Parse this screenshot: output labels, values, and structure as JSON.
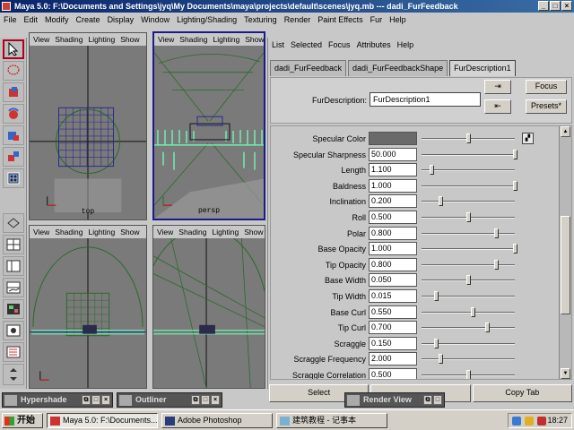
{
  "window": {
    "title": "Maya 5.0: F:\\Documents and Settings\\jyq\\My Documents\\maya\\projects\\default\\scenes\\jyq.mb  ---  dadi_FurFeedback",
    "buttons": [
      "_",
      "□",
      "×"
    ]
  },
  "menubar": [
    "File",
    "Edit",
    "Modify",
    "Create",
    "Display",
    "Window",
    "Lighting/Shading",
    "Texturing",
    "Render",
    "Paint Effects",
    "Fur",
    "Help"
  ],
  "viewports": [
    {
      "menu": [
        "View",
        "Shading",
        "Lighting",
        "Show"
      ],
      "label": "top"
    },
    {
      "menu": [
        "View",
        "Shading",
        "Lighting",
        "Show"
      ],
      "label": "persp"
    },
    {
      "menu": [
        "View",
        "Shading",
        "Lighting",
        "Show"
      ],
      "label": ""
    },
    {
      "menu": [
        "View",
        "Shading",
        "Lighting",
        "Show"
      ],
      "label": ""
    }
  ],
  "attribute_editor": {
    "menu": [
      "List",
      "Selected",
      "Focus",
      "Attributes",
      "Help"
    ],
    "tabs": [
      "dadi_FurFeedback",
      "dadi_FurFeedbackShape",
      "FurDescription1"
    ],
    "active_tab": 2,
    "field_label": "FurDescription:",
    "field_value": "FurDescription1",
    "focus_button": "Focus",
    "presets_button": "Presets*",
    "attributes": [
      {
        "label": "Specular Color",
        "value": "",
        "slider": 0.5,
        "color": "#6a6a6a",
        "map": true
      },
      {
        "label": "Specular Sharpness",
        "value": "50.000",
        "slider": 1.0
      },
      {
        "label": "Length",
        "value": "1.100",
        "slider": 0.11
      },
      {
        "label": "Baldness",
        "value": "1.000",
        "slider": 1.0
      },
      {
        "label": "Inclination",
        "value": "0.200",
        "slider": 0.2
      },
      {
        "label": "Roll",
        "value": "0.500",
        "slider": 0.5
      },
      {
        "label": "Polar",
        "value": "0.800",
        "slider": 0.8
      },
      {
        "label": "Base Opacity",
        "value": "1.000",
        "slider": 1.0
      },
      {
        "label": "Tip Opacity",
        "value": "0.800",
        "slider": 0.8
      },
      {
        "label": "Base Width",
        "value": "0.050",
        "slider": 0.5
      },
      {
        "label": "Tip Width",
        "value": "0.015",
        "slider": 0.15
      },
      {
        "label": "Base Curl",
        "value": "0.550",
        "slider": 0.55
      },
      {
        "label": "Tip Curl",
        "value": "0.700",
        "slider": 0.7
      },
      {
        "label": "Scraggle",
        "value": "0.150",
        "slider": 0.15
      },
      {
        "label": "Scraggle Frequency",
        "value": "2.000",
        "slider": 0.2
      },
      {
        "label": "Scraggle Correlation",
        "value": "0.500",
        "slider": 0.5
      }
    ],
    "bottom_buttons": [
      "Select",
      "",
      "Copy Tab"
    ]
  },
  "floating_panels": [
    {
      "title": "Hypershade",
      "controls": [
        "⧉",
        "□",
        "×"
      ]
    },
    {
      "title": "Outliner",
      "controls": [
        "⧉",
        "□",
        "×"
      ]
    },
    {
      "title": "Render View",
      "controls": [
        "⧉",
        "□"
      ]
    }
  ],
  "taskbar": {
    "start": "开始",
    "tasks": [
      "Maya 5.0: F:\\Documents...",
      "Adobe Photoshop",
      "建筑教程 - 记事本"
    ],
    "clock": "18:27"
  }
}
